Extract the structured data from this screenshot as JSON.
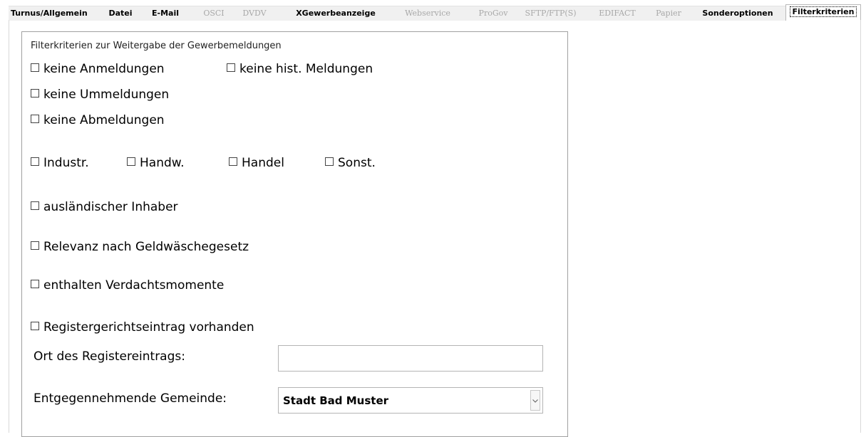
{
  "tabs": [
    {
      "label": "Turnus/Allgemein",
      "state": "enabled"
    },
    {
      "label": "Datei",
      "state": "enabled"
    },
    {
      "label": "E-Mail",
      "state": "enabled"
    },
    {
      "label": "OSCI",
      "state": "disabled"
    },
    {
      "label": "DVDV",
      "state": "disabled"
    },
    {
      "label": "XGewerbeanzeige",
      "state": "enabled"
    },
    {
      "label": "Webservice",
      "state": "disabled"
    },
    {
      "label": "ProGov",
      "state": "disabled"
    },
    {
      "label": "SFTP/FTP(S)",
      "state": "disabled"
    },
    {
      "label": "EDIFACT",
      "state": "disabled"
    },
    {
      "label": "Papier",
      "state": "disabled"
    },
    {
      "label": "Sonderoptionen",
      "state": "enabled"
    },
    {
      "label": "Filterkriterien",
      "state": "active"
    }
  ],
  "group": {
    "title": "Filterkriterien zur Weitergabe der Gewerbemeldungen"
  },
  "checkboxes": {
    "keine_anmeldungen": "keine Anmeldungen",
    "keine_hist_meldungen": "keine hist. Meldungen",
    "keine_ummeldungen": "keine Ummeldungen",
    "keine_abmeldungen": "keine Abmeldungen",
    "industr": "Industr.",
    "handw": "Handw.",
    "handel": "Handel",
    "sonst": "Sonst.",
    "auslaendischer_inhaber": "ausländischer Inhaber",
    "relevanz_gwg": "Relevanz nach Geldwäschegesetz",
    "verdachtsmomente": "enthalten Verdachtsmomente",
    "registergerichtseintrag": "Registergerichtseintrag vorhanden"
  },
  "fields": {
    "ort_label": "Ort des Registereintrags:",
    "ort_value": "",
    "gemeinde_label": "Entgegennehmende Gemeinde:",
    "gemeinde_value": "Stadt Bad Muster"
  },
  "colors": {
    "tab_disabled_text": "#a8a8a8",
    "tab_strip_bg": "#f0f0f0",
    "group_border": "#a0a0a0"
  }
}
